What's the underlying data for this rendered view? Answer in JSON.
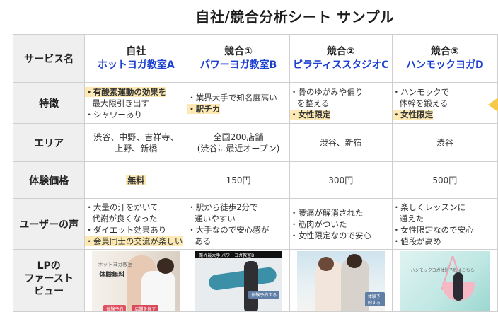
{
  "title": "自社/競合分析シート サンプル",
  "columns": [
    {
      "kind": "自社",
      "name": "ホットヨガ教室A"
    },
    {
      "kind": "競合①",
      "name": "パワーヨガ教室B"
    },
    {
      "kind": "競合②",
      "name": "ピラティススタジオC"
    },
    {
      "kind": "競合③",
      "name": "ハンモックヨガD"
    }
  ],
  "row_labels": {
    "service": "サービス名",
    "feature": "特徴",
    "area": "エリア",
    "price": "体験価格",
    "voice": "ユーザーの声",
    "lp": "LPの\nファースト\nビュー"
  },
  "features": {
    "a": [
      "・有酸素運動の効果を",
      "最大限引き出す",
      "・シャワーあり"
    ],
    "b": [
      "・業界大手で知名度高い",
      "・駅チカ"
    ],
    "c": [
      "・骨のゆがみや偏り",
      "を整える",
      "・女性限定"
    ],
    "d": [
      "・ハンモックで",
      "体幹を鍛える",
      "・女性限定"
    ]
  },
  "area": {
    "a": [
      "渋谷、中野、吉祥寺、",
      "上野、新橋"
    ],
    "b": [
      "全国200店舗",
      "(渋谷に最近オープン)"
    ],
    "c": [
      "渋谷、新宿"
    ],
    "d": [
      "渋谷"
    ]
  },
  "price": {
    "a": "無料",
    "b": "150円",
    "c": "300円",
    "d": "500円"
  },
  "voice": {
    "a": [
      "・大量の汗をかいて",
      "代謝が良くなった",
      "・ダイエット効果あり",
      "・会員同士の交流が楽しい"
    ],
    "b": [
      "・駅から徒歩2分で",
      "通いやすい",
      "・大手なので安心感が",
      "ある"
    ],
    "c": [
      "・腰痛が解消された",
      "・筋肉がついた",
      "・女性限定なので安心"
    ],
    "d": [
      "・楽しくレッスンに",
      "通えた",
      "・女性限定なので安心",
      "・値段が高め"
    ]
  },
  "lp": {
    "a": {
      "caption": "ホットヨガ教室",
      "headline": "体験無料",
      "btn1": "体験予約",
      "btn2": "店舗を探す"
    },
    "b": {
      "caption": "業界最大手 パワーヨガ教室B",
      "btn1": "体験予約する"
    },
    "c": {
      "btn1": "体験予約する"
    },
    "d": {
      "caption": "ハンモックヨガ体験予約はこちら"
    }
  },
  "colors": {
    "link": "#1a3fd1",
    "highlight": "#fde9b4",
    "header_bg": "#efefef",
    "grid": "#cfcfcf",
    "accent": "#f6c94a"
  }
}
